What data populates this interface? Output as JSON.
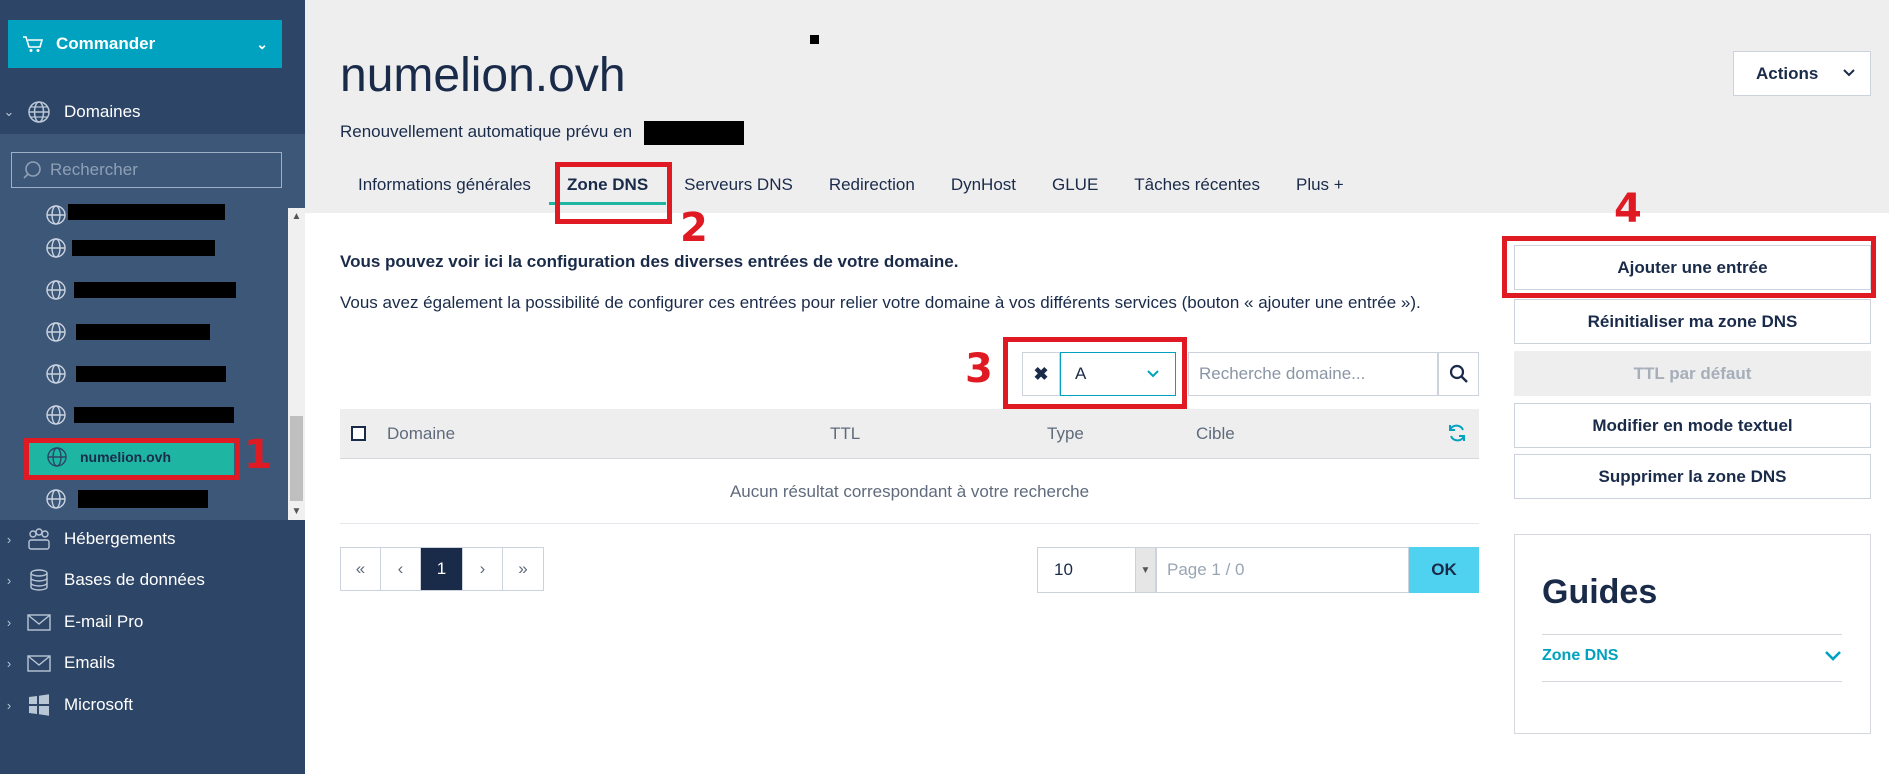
{
  "sidebar": {
    "order_label": "Commander",
    "domains_label": "Domaines",
    "search_placeholder": "Rechercher",
    "active_domain": "numelion.ovh",
    "sections": [
      {
        "label": "Hébergements",
        "icon": "hosting-icon"
      },
      {
        "label": "Bases de données",
        "icon": "database-icon"
      },
      {
        "label": "E-mail Pro",
        "icon": "mail-icon"
      },
      {
        "label": "Emails",
        "icon": "mail-icon"
      },
      {
        "label": "Microsoft",
        "icon": "windows-icon"
      }
    ]
  },
  "header": {
    "title": "numelion.ovh",
    "renewal_text": "Renouvellement automatique prévu en",
    "actions_label": "Actions",
    "tabs": [
      {
        "label": "Informations générales"
      },
      {
        "label": "Zone DNS",
        "active": true
      },
      {
        "label": "Serveurs DNS"
      },
      {
        "label": "Redirection"
      },
      {
        "label": "DynHost"
      },
      {
        "label": "GLUE"
      },
      {
        "label": "Tâches récentes"
      },
      {
        "label": "Plus +"
      }
    ]
  },
  "main": {
    "intro_bold": "Vous pouvez voir ici la configuration des diverses entrées de votre domaine.",
    "intro_text": "Vous avez également la possibilité de configurer ces entrées pour relier votre domaine à vos différents services (bouton « ajouter une entrée »).",
    "filter_clear": "✖",
    "filter_type_value": "A",
    "domain_search_placeholder": "Recherche domaine...",
    "table": {
      "columns": [
        "Domaine",
        "TTL",
        "Type",
        "Cible"
      ],
      "empty_message": "Aucun résultat correspondant à votre recherche"
    },
    "pagination": {
      "first": "«",
      "prev": "‹",
      "current": "1",
      "next": "›",
      "last": "»",
      "per_page": "10",
      "page_placeholder": "Page 1 / 0",
      "ok_label": "OK"
    }
  },
  "side_actions": {
    "add_entry": "Ajouter une entrée",
    "reset_zone": "Réinitialiser ma zone DNS",
    "default_ttl": "TTL par défaut",
    "text_mode": "Modifier en mode textuel",
    "delete_zone": "Supprimer la zone DNS"
  },
  "guides": {
    "title": "Guides",
    "item": "Zone DNS"
  },
  "annotations": {
    "n1": "1",
    "n2": "2",
    "n3": "3",
    "n4": "4"
  },
  "colors": {
    "sidebar_bg": "#2d4566",
    "accent_teal": "#00a2bf",
    "active_green": "#1fb5a3",
    "annotation_red": "#e01a22",
    "ok_button": "#4fd2f0"
  }
}
